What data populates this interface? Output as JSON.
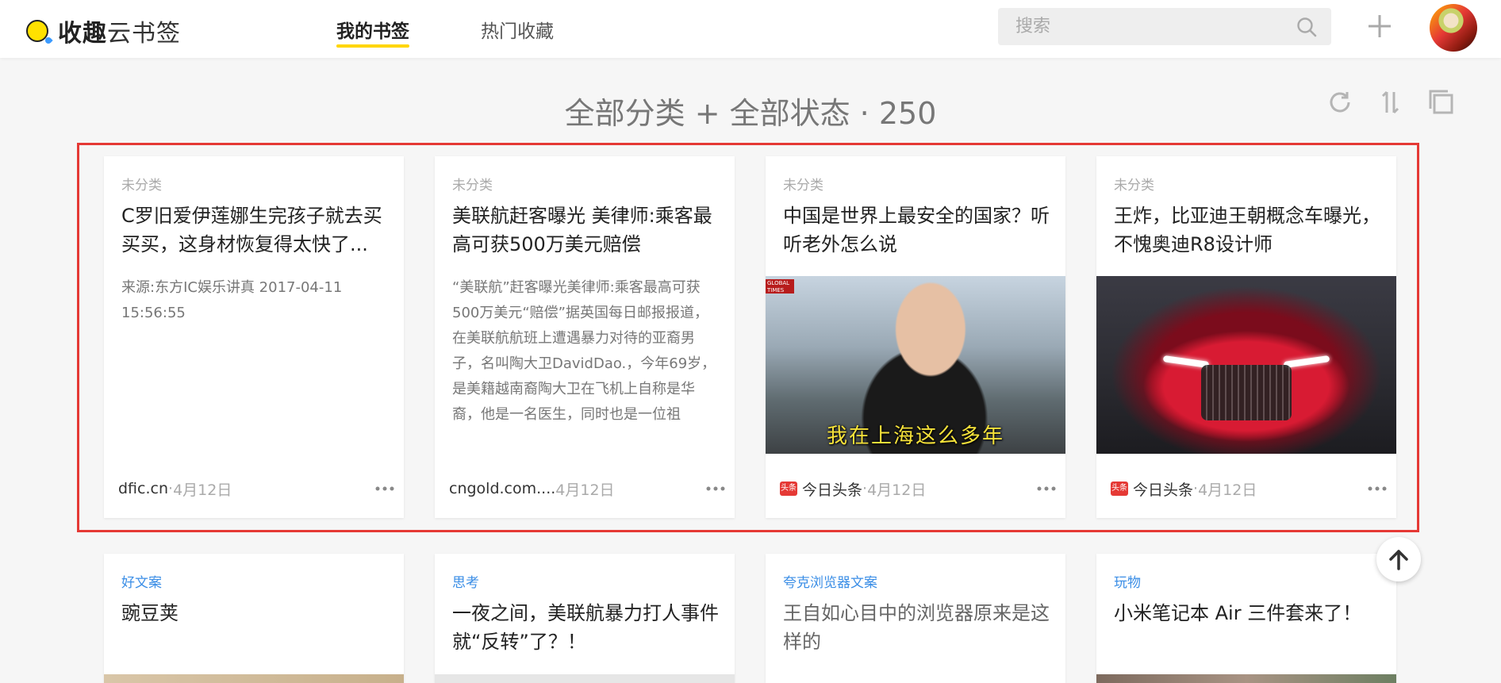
{
  "app": {
    "logo_bold": "收趣",
    "logo_rest": "云书签"
  },
  "nav": {
    "items": [
      {
        "label": "我的书签",
        "active": true
      },
      {
        "label": "热门收藏",
        "active": false
      }
    ]
  },
  "search": {
    "placeholder": "搜索"
  },
  "page": {
    "title": "全部分类 + 全部状态 · 250"
  },
  "cards": [
    {
      "category": "未分类",
      "title": "C罗旧爱伊莲娜生完孩子就去买买买，这身材恢复得太快了...",
      "description": "来源:东方IC娱乐讲真 2017-04-11 15:56:55",
      "source": "dfic.cn",
      "date": "4月12日"
    },
    {
      "category": "未分类",
      "title": "美联航赶客曝光 美律师:乘客最高可获500万美元赔偿",
      "description": "“美联航”赶客曝光美律师:乘客最高可获500万美元“赔偿”据英国每日邮报报道，在美联航航班上遭遇暴力对待的亚裔男子，名叫陶大卫DavidDao.，今年69岁，是美籍越南裔陶大卫在飞机上自称是华裔，他是一名医生，同时也是一位祖",
      "source": "cngold.com....",
      "date": "4月12日"
    },
    {
      "category": "未分类",
      "title": "中国是世界上最安全的国家？听听老外怎么说",
      "image_caption": "我在上海这么多年",
      "image_logo": "GLOBAL TIMES",
      "source_badge": "头条",
      "source": "今日头条",
      "date": "4月12日"
    },
    {
      "category": "未分类",
      "title": "王炸，比亚迪王朝概念车曝光，不愧奥迪R8设计师",
      "source_badge": "头条",
      "source": "今日头条",
      "date": "4月12日"
    },
    {
      "category": "好文案",
      "title": "豌豆荚"
    },
    {
      "category": "思考",
      "title": "一夜之间，美联航暴力打人事件就“反转”了？！"
    },
    {
      "category": "夸克浏览器文案",
      "title": "王自如心目中的浏览器原来是这样的"
    },
    {
      "category": "玩物",
      "title": "小米笔记本 Air 三件套来了！"
    }
  ],
  "colors": {
    "accent": "#ffd600",
    "highlight": "#e53935",
    "category_link": "#3b8ee6"
  },
  "icons": [
    "search-icon",
    "plus-icon",
    "refresh-icon",
    "sort-icon",
    "copy-icon",
    "more-icon",
    "arrow-up-icon"
  ]
}
